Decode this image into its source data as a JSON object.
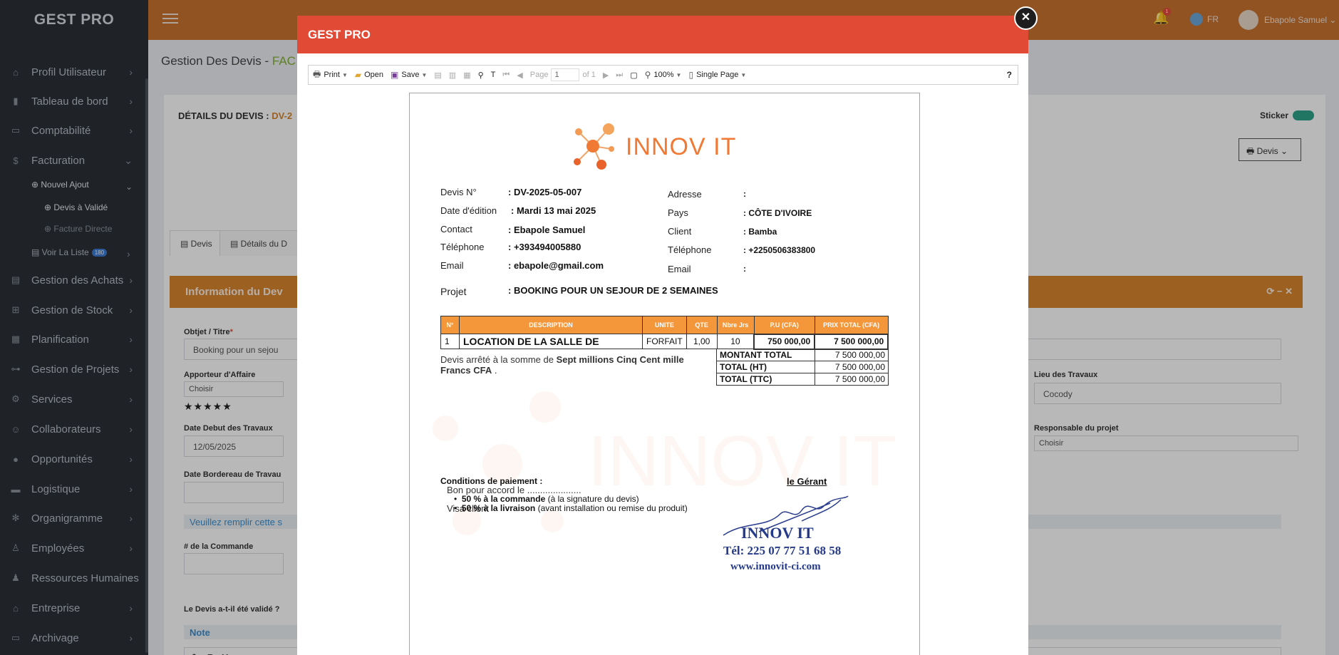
{
  "app": {
    "brand": "GEST PRO"
  },
  "sidebar": {
    "items": [
      {
        "label": "Profil Utilisateur",
        "icon": "home-icon"
      },
      {
        "label": "Tableau de bord",
        "icon": "bar-chart-icon"
      },
      {
        "label": "Comptabilité",
        "icon": "book-icon"
      },
      {
        "label": "Facturation",
        "icon": "dollar-icon"
      },
      {
        "label": "Gestion des Achats",
        "icon": "file-icon"
      },
      {
        "label": "Gestion de Stock",
        "icon": "sitemap-icon"
      },
      {
        "label": "Planification",
        "icon": "calendar-icon"
      },
      {
        "label": "Gestion de Projets",
        "icon": "project-icon"
      },
      {
        "label": "Services",
        "icon": "gear-icon"
      },
      {
        "label": "Collaborateurs",
        "icon": "users-icon"
      },
      {
        "label": "Opportunités",
        "icon": "globe-icon"
      },
      {
        "label": "Logistique",
        "icon": "truck-icon"
      },
      {
        "label": "Organigramme",
        "icon": "org-icon"
      },
      {
        "label": "Employées",
        "icon": "people-icon"
      },
      {
        "label": "Ressources Humaines",
        "icon": "person-icon"
      },
      {
        "label": "Entreprise",
        "icon": "building-icon"
      },
      {
        "label": "Archivage",
        "icon": "archive-icon"
      }
    ],
    "sub_nouvel_ajout": "Nouvel Ajout",
    "sub_devis_valide": "Devis à Validé",
    "sub_facture_directe": "Facture Directe",
    "sub_voir_liste": "Voir La Liste",
    "voir_liste_badge": "180"
  },
  "topbar": {
    "notif_count": "1",
    "lang": "FR",
    "user_name": "Ebapole Samuel"
  },
  "page": {
    "title": "Gestion Des Devis - ",
    "title_highlight": "FAC",
    "details_label": "DÉTAILS DU DEVIS : ",
    "details_value": "DV-2",
    "sticker": "Sticker",
    "devis_btn": "Devis",
    "tab_devis": "Devis",
    "tab_details": "Détails du D",
    "section_title": "Information du Dev",
    "objet_label": "Obtjet / Titre",
    "objet_value": "Booking pour un sejou",
    "apporteur_label": "Apporteur d'Affaire",
    "apporteur_value": "Choisir",
    "stars": "★★★★★",
    "date_debut_label": "Date Debut des Travaux",
    "date_debut_value": "12/05/2025",
    "bordereau_label": "Date Bordereau de Travau",
    "remplir_note": "Veuillez remplir cette s",
    "commande_label": "# de la Commande",
    "valide_label": "Le Devis a-t-il été validé ?",
    "note_label": "Note",
    "lieu_label": "Lieu des Travaux",
    "lieu_value": "Cocody",
    "responsable_label": "Responsable du projet",
    "responsable_value": "Choisir"
  },
  "modal": {
    "title": "GEST PRO",
    "toolbar": {
      "print": "Print",
      "open": "Open",
      "save": "Save",
      "page_label": "Page",
      "page_value": "1",
      "of_pages": "of 1",
      "zoom": "100%",
      "view_mode": "Single Page",
      "help": "?"
    },
    "document": {
      "logo_text": "INNOV IT",
      "devis_no_label": "Devis N°",
      "devis_no": ": DV-2025-05-007",
      "date_label": "Date d'édition",
      "date": ": Mardi 13 mai 2025",
      "contact_label": "Contact",
      "contact": ": Ebapole Samuel",
      "tel_label": "Téléphone",
      "tel": ": +393494005880",
      "email_label": "Email",
      "email": ": ebapole@gmail.com",
      "projet_label": "Projet",
      "projet": ": BOOKING POUR UN SEJOUR DE 2 SEMAINES",
      "adresse_label": "Adresse",
      "adresse": ":",
      "pays_label": "Pays",
      "pays": ": CÔTE D'IVOIRE",
      "client_label": "Client",
      "client": ": Bamba",
      "client_tel_label": "Téléphone",
      "client_tel": ": +2250506383800",
      "client_email_label": "Email",
      "client_email": ":",
      "table_headers": [
        "N°",
        "DESCRIPTION",
        "UNITE",
        "QTE",
        "Nbre Jrs",
        "P.U (CFA)",
        "PRIX TOTAL (CFA)"
      ],
      "row": {
        "n": "1",
        "description": "LOCATION DE LA SALLE DE",
        "unite": "FORFAIT",
        "qte": "1,00",
        "jrs": "10",
        "pu": "750 000,00",
        "total": "7 500 000,00"
      },
      "totals": [
        {
          "label": "MONTANT TOTAL",
          "value": "7 500 000,00"
        },
        {
          "label": "TOTAL (HT)",
          "value": "7 500 000,00"
        },
        {
          "label": "TOTAL (TTC)",
          "value": "7 500 000,00"
        }
      ],
      "arrete_prefix": "Devis arrêté à la somme de ",
      "arrete_amount": "Sept millions Cinq Cent mille Francs CFA",
      "arrete_suffix": " .",
      "conditions_title": "Conditions de paiement :",
      "bon_pour_accord": "Bon pour accord le .....................",
      "cond1_bold": "50 % à la commande",
      "cond1_rest": " (à la signature du devis)",
      "cond2_bold": "50 % à la livraison",
      "cond2_rest": " (avant installation ou remise du produit)",
      "visa": "Visa client",
      "gerant": "le Gérant",
      "stamp_name": "INNOV IT",
      "stamp_tel": "Tél: 225 07 77 51 68 58",
      "stamp_web": "www.innovit-ci.com"
    }
  },
  "colors": {
    "sidebar": "#2c3138",
    "topbar": "#c9732f",
    "modal_header": "#e14a35",
    "table_header": "#f4963a",
    "logo": "#f07a34",
    "stamp": "#253a8a"
  }
}
